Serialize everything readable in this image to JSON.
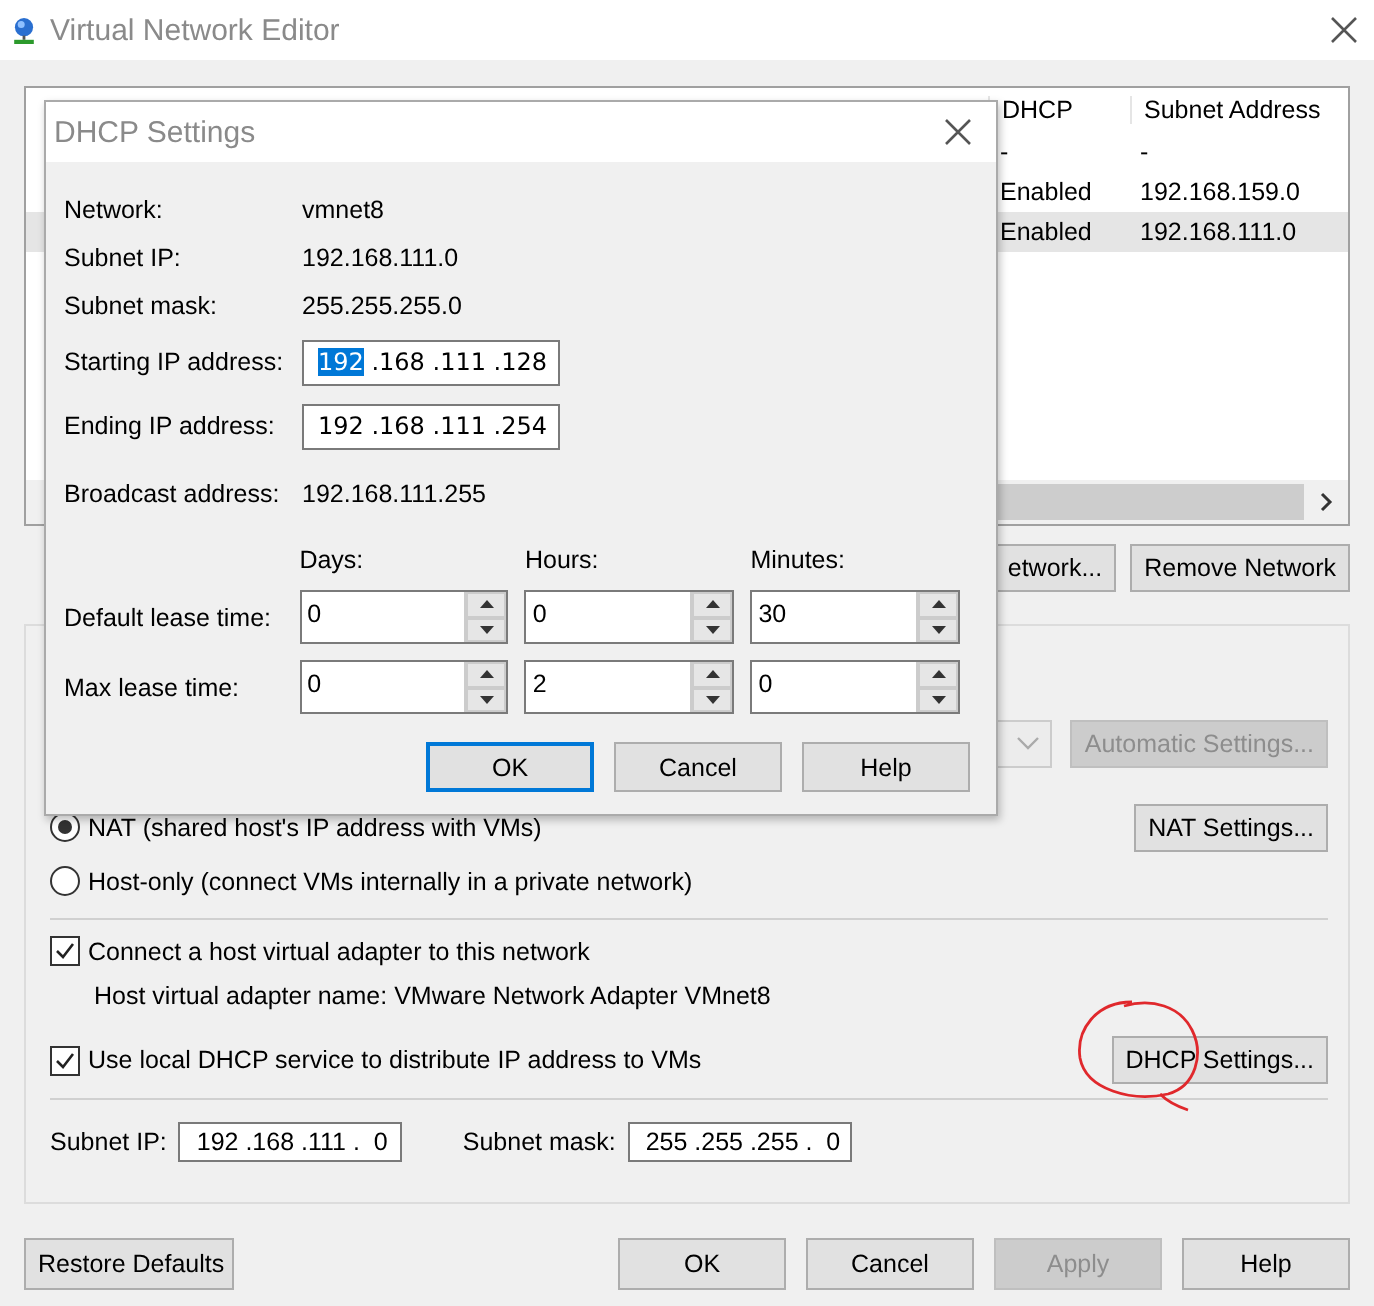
{
  "window": {
    "title": "Virtual Network Editor"
  },
  "table": {
    "columns": [
      "DHCP",
      "Subnet Address"
    ],
    "rows": [
      {
        "cells": [
          "-",
          "-"
        ],
        "selected": false
      },
      {
        "cells": [
          "Enabled",
          "192.168.159.0"
        ],
        "selected": false
      },
      {
        "cells": [
          "Enabled",
          "192.168.111.0"
        ],
        "selected": true
      }
    ]
  },
  "network_buttons": [
    {
      "label": "etwork...",
      "disabled": false
    },
    {
      "label": "Remove Network",
      "disabled": false
    }
  ],
  "connection": {
    "combo": {
      "disabled": true
    },
    "auto_button": {
      "label": "Automatic Settings...",
      "disabled": true
    },
    "radios": [
      {
        "label": "NAT (shared host's IP address with VMs)",
        "checked": true,
        "button": {
          "label": "NAT Settings...",
          "disabled": false
        }
      },
      {
        "label": "Host-only (connect VMs internally in a private network)",
        "checked": false
      }
    ]
  },
  "adapter": {
    "label": "Connect a host virtual adapter to this network",
    "checked": true,
    "name_text": "Host virtual adapter name: VMware Network Adapter VMnet8"
  },
  "dhcp": {
    "label": "Use local DHCP service to distribute IP address to VMs",
    "checked": true,
    "button": {
      "label": "DHCP Settings...",
      "disabled": false
    }
  },
  "subnet": {
    "ip_label": "Subnet IP:",
    "ip": "192 .168 .111 .  0",
    "mask_label": "Subnet mask:",
    "mask": "255 .255 .255 .  0"
  },
  "footer_buttons": [
    {
      "label": "Restore Defaults",
      "disabled": false
    },
    {
      "label": "OK",
      "disabled": false
    },
    {
      "label": "Cancel",
      "disabled": false
    },
    {
      "label": "Apply",
      "disabled": true
    },
    {
      "label": "Help",
      "disabled": false
    }
  ],
  "annotation": {
    "kind": "circle"
  },
  "dialog": {
    "title": "DHCP Settings",
    "info": [
      {
        "label": "Network:",
        "value": "vmnet8"
      },
      {
        "label": "Subnet IP:",
        "value": "192.168.111.0"
      },
      {
        "label": "Subnet mask:",
        "value": "255.255.255.0"
      }
    ],
    "ip_fields": [
      {
        "label": "Starting IP address:",
        "parts": [
          {
            "text": "192",
            "selected": true
          },
          {
            "text": " .168 .111 .128",
            "selected": false
          }
        ]
      },
      {
        "label": "Ending IP address:",
        "parts": [
          {
            "text": "192 .168 .111 .254",
            "selected": false
          }
        ]
      }
    ],
    "broadcast": {
      "label": "Broadcast address:",
      "value": "192.168.111.255"
    },
    "lease": {
      "columns": [
        "Days:",
        "Hours:",
        "Minutes:"
      ],
      "rows": [
        {
          "label": "Default lease time:",
          "values": [
            "0",
            "0",
            "30"
          ]
        },
        {
          "label": "Max lease time:",
          "values": [
            "0",
            "2",
            "0"
          ]
        }
      ]
    },
    "buttons": [
      {
        "label": "OK",
        "default": true
      },
      {
        "label": "Cancel",
        "default": false
      },
      {
        "label": "Help",
        "default": false
      }
    ]
  }
}
